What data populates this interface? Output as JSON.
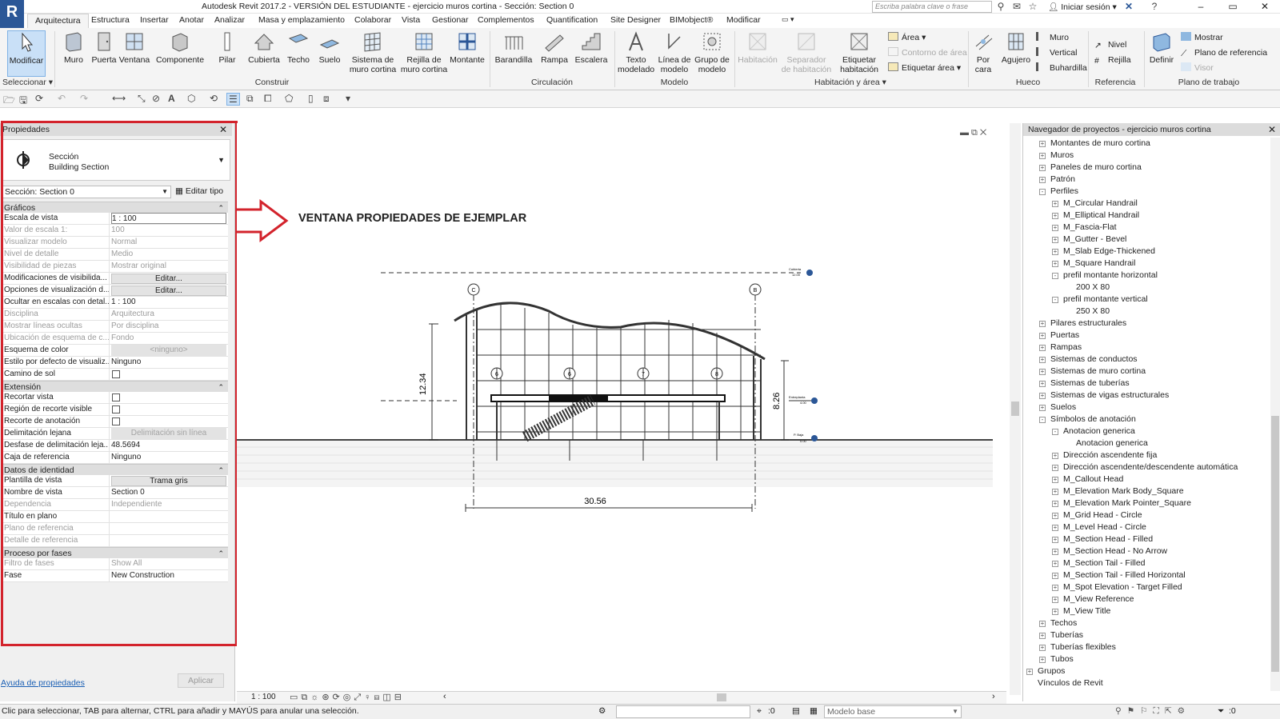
{
  "window": {
    "title": "Autodesk Revit 2017.2 - VERSIÓN DEL ESTUDIANTE -    ejercicio muros cortina - Sección: Section 0",
    "app_button": "R",
    "search_placeholder": "Escriba palabra clave o frase",
    "signin": "Iniciar sesión",
    "controls": {
      "minimize": "–",
      "maximize": "▭",
      "close": "✕"
    }
  },
  "tabs": [
    "Arquitectura",
    "Estructura",
    "Insertar",
    "Anotar",
    "Analizar",
    "Masa y emplazamiento",
    "Colaborar",
    "Vista",
    "Gestionar",
    "Complementos",
    "Quantification",
    "Site Designer",
    "BIMobject®",
    "Modificar"
  ],
  "ribbon": {
    "buttons": [
      {
        "label": "Modificar",
        "icon": "cursor-arrow-icon"
      },
      {
        "label": "Muro",
        "icon": "wall-icon"
      },
      {
        "label": "Puerta",
        "icon": "door-icon"
      },
      {
        "label": "Ventana",
        "icon": "window-icon"
      },
      {
        "label": "Componente",
        "icon": "component-icon"
      },
      {
        "label": "Pilar",
        "icon": "column-icon"
      },
      {
        "label": "Cubierta",
        "icon": "roof-icon"
      },
      {
        "label": "Techo",
        "icon": "ceiling-icon"
      },
      {
        "label": "Suelo",
        "icon": "floor-icon"
      },
      {
        "label": "Sistema de\nmuro cortina",
        "icon": "curtain-system-icon"
      },
      {
        "label": "Rejilla de\nmuro cortina",
        "icon": "curtain-grid-icon"
      },
      {
        "label": "Montante",
        "icon": "mullion-icon"
      },
      {
        "label": "Barandilla",
        "icon": "railing-icon"
      },
      {
        "label": "Rampa",
        "icon": "ramp-icon"
      },
      {
        "label": "Escalera",
        "icon": "stair-icon"
      },
      {
        "label": "Texto\nmodelado",
        "icon": "model-text-icon"
      },
      {
        "label": "Línea de\nmodelo",
        "icon": "model-line-icon"
      },
      {
        "label": "Grupo de\nmodelo",
        "icon": "model-group-icon"
      },
      {
        "label": "Habitación",
        "icon": "room-icon"
      },
      {
        "label": "Separador\nde habitación",
        "icon": "room-separator-icon"
      },
      {
        "label": "Etiquetar\nhabitación",
        "icon": "tag-room-icon"
      },
      {
        "label": "Por\ncara",
        "icon": "by-face-icon"
      },
      {
        "label": "Agujero",
        "icon": "shaft-icon"
      },
      {
        "label": "Definir",
        "icon": "set-workplane-icon"
      }
    ],
    "small": {
      "area": "Área",
      "area_boundary": "Contorno de área",
      "tag_area": "Etiquetar  área",
      "wall": "Muro",
      "vertical": "Vertical",
      "dormer": "Buhardilla",
      "level": "Nivel",
      "grid": "Rejilla",
      "show": "Mostrar",
      "ref_plane": "Plano de referencia",
      "viewer": "Visor"
    },
    "panels": {
      "select": "Seleccionar",
      "build": "Construir",
      "circulation": "Circulación",
      "model": "Modelo",
      "room_area": "Habitación y área",
      "opening": "Hueco",
      "datum": "Referencia",
      "workplane": "Plano de trabajo"
    }
  },
  "properties": {
    "header": "Propiedades",
    "type_category": "Sección",
    "type_name": "Building Section",
    "instance_selector": "Sección: Section 0",
    "edit_type": "Editar tipo",
    "sections": [
      {
        "title": "Gráficos",
        "rows": [
          {
            "key": "Escala de vista",
            "value": "1 : 100",
            "style": "input"
          },
          {
            "key": "Valor de escala    1:",
            "value": "100",
            "style": "gray"
          },
          {
            "key": "Visualizar modelo",
            "value": "Normal",
            "style": "gray"
          },
          {
            "key": "Nivel de detalle",
            "value": "Medio",
            "style": "gray"
          },
          {
            "key": "Visibilidad de piezas",
            "value": "Mostrar original",
            "style": "gray"
          },
          {
            "key": "Modificaciones de visibilida...",
            "value": "Editar...",
            "style": "button"
          },
          {
            "key": "Opciones de visualización d...",
            "value": "Editar...",
            "style": "button"
          },
          {
            "key": "Ocultar en escalas con detal...",
            "value": "1 : 100",
            "style": "normal"
          },
          {
            "key": "Disciplina",
            "value": "Arquitectura",
            "style": "gray"
          },
          {
            "key": "Mostrar líneas ocultas",
            "value": "Por disciplina",
            "style": "gray"
          },
          {
            "key": "Ubicación de esquema de c...",
            "value": "Fondo",
            "style": "gray"
          },
          {
            "key": "Esquema de color",
            "value": "<ninguno>",
            "style": "grayfill"
          },
          {
            "key": "Estilo por defecto de visualiz...",
            "value": "Ninguno",
            "style": "normal"
          },
          {
            "key": "Camino de sol",
            "value": "",
            "style": "checkbox"
          }
        ]
      },
      {
        "title": "Extensión",
        "rows": [
          {
            "key": "Recortar vista",
            "value": "",
            "style": "checkbox"
          },
          {
            "key": "Región de recorte visible",
            "value": "",
            "style": "checkbox"
          },
          {
            "key": "Recorte de anotación",
            "value": "",
            "style": "checkbox"
          },
          {
            "key": "Delimitación lejana",
            "value": "Delimitación sin línea",
            "style": "grayfill"
          },
          {
            "key": "Desfase de delimitación leja...",
            "value": "48.5694",
            "style": "normal"
          },
          {
            "key": "Caja de referencia",
            "value": "Ninguno",
            "style": "normal"
          }
        ]
      },
      {
        "title": "Datos de identidad",
        "rows": [
          {
            "key": "Plantilla de vista",
            "value": "Trama gris",
            "style": "button"
          },
          {
            "key": "Nombre de vista",
            "value": "Section 0",
            "style": "normal"
          },
          {
            "key": "Dependencia",
            "value": "Independiente",
            "style": "gray"
          },
          {
            "key": "Título en plano",
            "value": "",
            "style": "normal"
          },
          {
            "key": "Plano de referencia",
            "value": "",
            "style": "gray"
          },
          {
            "key": "Detalle de referencia",
            "value": "",
            "style": "gray"
          }
        ]
      },
      {
        "title": "Proceso por fases",
        "rows": [
          {
            "key": "Filtro de fases",
            "value": "Show All",
            "style": "gray"
          },
          {
            "key": "Fase",
            "value": "New Construction",
            "style": "normal"
          }
        ]
      }
    ],
    "help_link": "Ayuda de propiedades",
    "apply": "Aplicar"
  },
  "annotation": {
    "text": "VENTANA PROPIEDADES DE EJEMPLAR",
    "arrow_color": "#d3232c",
    "outline_color": "#d3232c"
  },
  "drawing": {
    "dimension_width": "30.56",
    "dimension_height_left": "12.34",
    "dimension_height_right": "8.26",
    "grid_top_left": "C",
    "grid_top_right": "B",
    "grid_mid": [
      "6",
      "6",
      "7",
      "8"
    ],
    "level_top": "Cubierta",
    "level_top_elev": "12.00",
    "level_mid": "Entreplanta",
    "level_mid_elev": "4.00",
    "level_base": "P. Baja",
    "level_base_elev": "0.00"
  },
  "view_bar": {
    "scale": "1 : 100"
  },
  "browser": {
    "header": "Navegador de proyectos - ejercicio muros cortina",
    "nodes": [
      {
        "label": "Montantes de muro cortina",
        "level": 1,
        "toggle": "+"
      },
      {
        "label": "Muros",
        "level": 1,
        "toggle": "+"
      },
      {
        "label": "Paneles de muro cortina",
        "level": 1,
        "toggle": "+"
      },
      {
        "label": "Patrón",
        "level": 1,
        "toggle": "+"
      },
      {
        "label": "Perfiles",
        "level": 1,
        "toggle": "-"
      },
      {
        "label": "M_Circular Handrail",
        "level": 2,
        "toggle": "+"
      },
      {
        "label": "M_Elliptical Handrail",
        "level": 2,
        "toggle": "+"
      },
      {
        "label": "M_Fascia-Flat",
        "level": 2,
        "toggle": "+"
      },
      {
        "label": "M_Gutter - Bevel",
        "level": 2,
        "toggle": "+"
      },
      {
        "label": "M_Slab Edge-Thickened",
        "level": 2,
        "toggle": "+"
      },
      {
        "label": "M_Square Handrail",
        "level": 2,
        "toggle": "+"
      },
      {
        "label": "prefil montante horizontal",
        "level": 2,
        "toggle": "-"
      },
      {
        "label": "200 X 80",
        "level": 3,
        "toggle": ""
      },
      {
        "label": "prefil montante vertical",
        "level": 2,
        "toggle": "-"
      },
      {
        "label": "250 X 80",
        "level": 3,
        "toggle": ""
      },
      {
        "label": "Pilares estructurales",
        "level": 1,
        "toggle": "+"
      },
      {
        "label": "Puertas",
        "level": 1,
        "toggle": "+"
      },
      {
        "label": "Rampas",
        "level": 1,
        "toggle": "+"
      },
      {
        "label": "Sistemas de conductos",
        "level": 1,
        "toggle": "+"
      },
      {
        "label": "Sistemas de muro cortina",
        "level": 1,
        "toggle": "+"
      },
      {
        "label": "Sistemas de tuberías",
        "level": 1,
        "toggle": "+"
      },
      {
        "label": "Sistemas de vigas estructurales",
        "level": 1,
        "toggle": "+"
      },
      {
        "label": "Suelos",
        "level": 1,
        "toggle": "+"
      },
      {
        "label": "Símbolos de anotación",
        "level": 1,
        "toggle": "-"
      },
      {
        "label": "Anotacion generica",
        "level": 2,
        "toggle": "-"
      },
      {
        "label": "Anotacion generica",
        "level": 3,
        "toggle": ""
      },
      {
        "label": "Dirección ascendente fija",
        "level": 2,
        "toggle": "+"
      },
      {
        "label": "Dirección ascendente/descendente automática",
        "level": 2,
        "toggle": "+"
      },
      {
        "label": "M_Callout Head",
        "level": 2,
        "toggle": "+"
      },
      {
        "label": "M_Elevation Mark Body_Square",
        "level": 2,
        "toggle": "+"
      },
      {
        "label": "M_Elevation Mark Pointer_Square",
        "level": 2,
        "toggle": "+"
      },
      {
        "label": "M_Grid Head - Circle",
        "level": 2,
        "toggle": "+"
      },
      {
        "label": "M_Level Head - Circle",
        "level": 2,
        "toggle": "+"
      },
      {
        "label": "M_Section Head - Filled",
        "level": 2,
        "toggle": "+"
      },
      {
        "label": "M_Section Head - No Arrow",
        "level": 2,
        "toggle": "+"
      },
      {
        "label": "M_Section Tail - Filled",
        "level": 2,
        "toggle": "+"
      },
      {
        "label": "M_Section Tail - Filled Horizontal",
        "level": 2,
        "toggle": "+"
      },
      {
        "label": "M_Spot Elevation - Target Filled",
        "level": 2,
        "toggle": "+"
      },
      {
        "label": "M_View Reference",
        "level": 2,
        "toggle": "+"
      },
      {
        "label": "M_View Title",
        "level": 2,
        "toggle": "+"
      },
      {
        "label": "Techos",
        "level": 1,
        "toggle": "+"
      },
      {
        "label": "Tuberías",
        "level": 1,
        "toggle": "+"
      },
      {
        "label": "Tuberías flexibles",
        "level": 1,
        "toggle": "+"
      },
      {
        "label": "Tubos",
        "level": 1,
        "toggle": "+"
      },
      {
        "label": "Grupos",
        "level": 0,
        "toggle": "+"
      },
      {
        "label": "Vínculos de Revit",
        "level": 0,
        "toggle": ""
      }
    ]
  },
  "status": {
    "text": "Clic para seleccionar, TAB para alternar, CTRL para añadir y MAYÚS para anular una selección.",
    "zero": ":0",
    "model": "Modelo base",
    "filter_count": ":0"
  }
}
